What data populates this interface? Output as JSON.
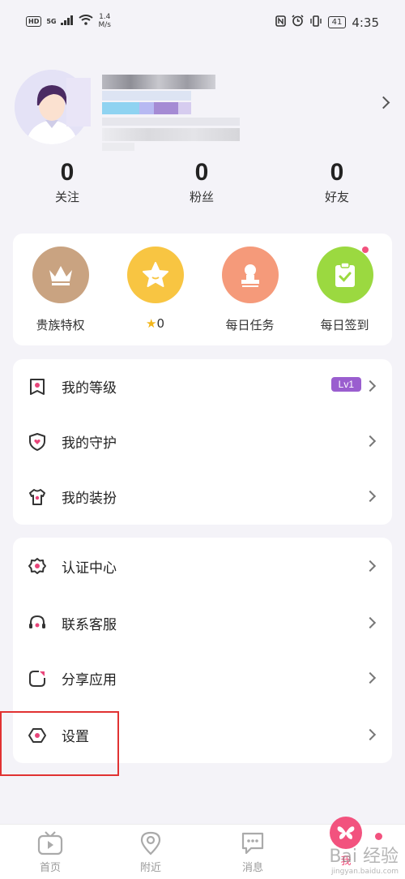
{
  "status_bar": {
    "hd": "HD",
    "network": "5G",
    "speed": "1.4",
    "speed_unit": "M/s",
    "battery": "41",
    "time": "4:35"
  },
  "profile": {
    "following_count": "0",
    "following_label": "关注",
    "fans_count": "0",
    "fans_label": "粉丝",
    "friends_count": "0",
    "friends_label": "好友"
  },
  "quick_actions": [
    {
      "label": "贵族特权",
      "color": "#c9a381",
      "icon": "crown-icon"
    },
    {
      "label": "0",
      "color": "#f8c542",
      "icon": "star-icon"
    },
    {
      "label": "每日任务",
      "color": "#f59a7a",
      "icon": "person-stamp-icon"
    },
    {
      "label": "每日签到",
      "color": "#9bd940",
      "icon": "clipboard-check-icon"
    }
  ],
  "menu_group_1": [
    {
      "label": "我的等级",
      "badge": "Lv1",
      "icon": "ribbon-icon"
    },
    {
      "label": "我的守护",
      "icon": "shield-heart-icon"
    },
    {
      "label": "我的装扮",
      "icon": "shirt-icon"
    }
  ],
  "menu_group_2": [
    {
      "label": "认证中心",
      "icon": "badge-icon"
    },
    {
      "label": "联系客服",
      "icon": "headset-icon"
    },
    {
      "label": "分享应用",
      "icon": "share-icon"
    },
    {
      "label": "设置",
      "icon": "settings-hexagon-icon"
    }
  ],
  "tabbar": [
    {
      "label": "首页",
      "icon": "tv-icon"
    },
    {
      "label": "附近",
      "icon": "location-pin-icon"
    },
    {
      "label": "消息",
      "icon": "chat-bubble-icon"
    },
    {
      "label": "我",
      "icon": "butterfly-icon"
    }
  ],
  "watermark": {
    "text": "Bai 经验",
    "sub": "jingyan.baidu.com"
  },
  "colors": {
    "accent": "#f2527e",
    "badge": "#9a5ecf",
    "highlight": "#e13232"
  }
}
